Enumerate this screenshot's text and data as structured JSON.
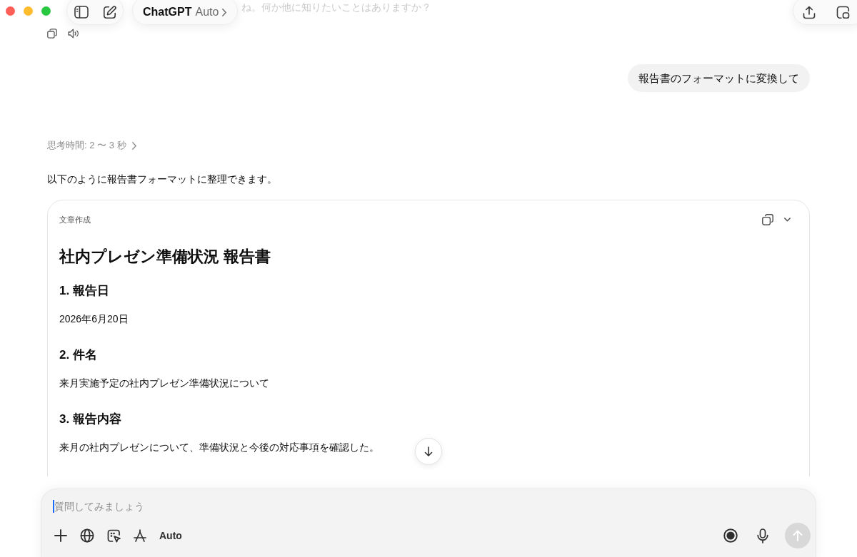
{
  "header": {
    "title": "ChatGPT",
    "model": "Auto"
  },
  "previous_message": {
    "text": "ね。何か他に知りたいことはありますか？"
  },
  "user_message": {
    "text": "報告書のフォーマットに変換して"
  },
  "response": {
    "thinking": "思考時間: 2 〜 3 秒",
    "intro": "以下のように報告書フォーマットに整理できます。",
    "document": {
      "label": "文章作成",
      "title": "社内プレゼン準備状況 報告書",
      "blocks": [
        {
          "kind": "heading",
          "text": "1. 報告日"
        },
        {
          "kind": "paragraph",
          "text": "2026年6月20日"
        },
        {
          "kind": "heading",
          "text": "2. 件名"
        },
        {
          "kind": "paragraph",
          "text": "来月実施予定の社内プレゼン準備状況について"
        },
        {
          "kind": "heading",
          "text": "3. 報告内容"
        },
        {
          "kind": "paragraph",
          "text": "来月の社内プレゼンについて、準備状況と今後の対応事項を確認した。"
        }
      ]
    }
  },
  "composer": {
    "placeholder": "質問してみましょう",
    "mode": "Auto",
    "send_disabled": true
  }
}
